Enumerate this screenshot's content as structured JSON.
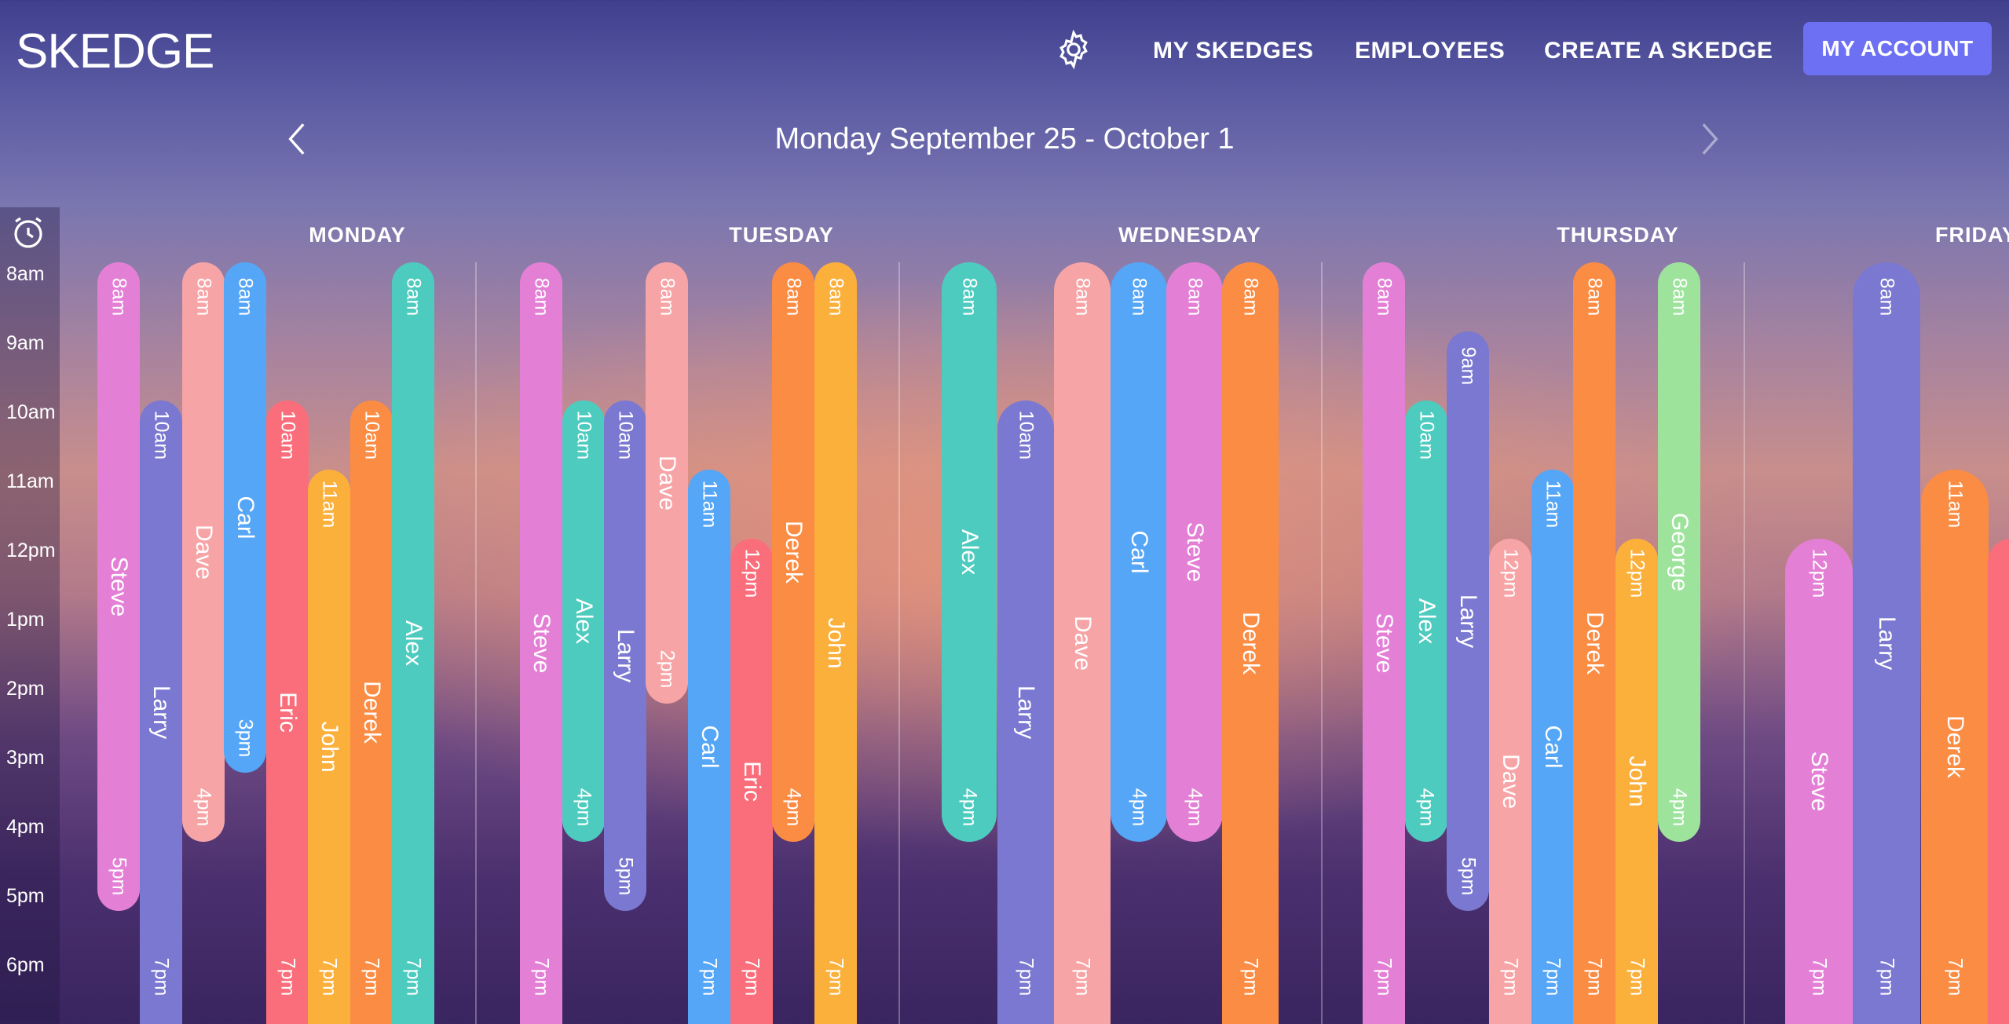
{
  "app": {
    "logo": "SKEDGE"
  },
  "nav": {
    "settings_icon": "gear-icon",
    "my_skedges": "MY SKEDGES",
    "employees": "EMPLOYEES",
    "create": "CREATE A SKEDGE",
    "account": "MY ACCOUNT"
  },
  "week": {
    "label": "Monday September 25 - October 1",
    "prev_icon": "chevron-left-icon",
    "next_icon": "chevron-right-icon"
  },
  "time_column": {
    "icon": "alarm-clock-icon",
    "hours": [
      "8am",
      "9am",
      "10am",
      "11am",
      "12pm",
      "1pm",
      "2pm",
      "3pm",
      "4pm",
      "5pm",
      "6pm"
    ]
  },
  "colors": {
    "pink": "#e47fd6",
    "periwinkle": "#7b78d1",
    "salmon": "#f7a4a6",
    "blue": "#55a6f6",
    "red": "#fa6e7b",
    "yellow": "#fbb03b",
    "orange": "#fb8c43",
    "teal": "#4ecbbf",
    "green": "#9de39c",
    "button": "#6d70f2"
  },
  "days": [
    {
      "name": "MONDAY",
      "shifts": [
        {
          "employee": "Steve",
          "start": "8am",
          "end": "5pm",
          "color": "#e47fd6"
        },
        {
          "employee": "Larry",
          "start": "10am",
          "end": "7pm",
          "color": "#7b78d1"
        },
        {
          "employee": "Dave",
          "start": "8am",
          "end": "4pm",
          "color": "#f7a4a6"
        },
        {
          "employee": "Carl",
          "start": "8am",
          "end": "3pm",
          "color": "#55a6f6"
        },
        {
          "employee": "Eric",
          "start": "10am",
          "end": "7pm",
          "color": "#fa6e7b"
        },
        {
          "employee": "John",
          "start": "11am",
          "end": "7pm",
          "color": "#fbb03b"
        },
        {
          "employee": "Derek",
          "start": "10am",
          "end": "7pm",
          "color": "#fb8c43"
        },
        {
          "employee": "Alex",
          "start": "8am",
          "end": "7pm",
          "color": "#4ecbbf"
        }
      ]
    },
    {
      "name": "TUESDAY",
      "shifts": [
        {
          "employee": "Steve",
          "start": "8am",
          "end": "7pm",
          "color": "#e47fd6"
        },
        {
          "employee": "Alex",
          "start": "10am",
          "end": "4pm",
          "color": "#4ecbbf"
        },
        {
          "employee": "Larry",
          "start": "10am",
          "end": "5pm",
          "color": "#7b78d1"
        },
        {
          "employee": "Dave",
          "start": "8am",
          "end": "2pm",
          "color": "#f7a4a6"
        },
        {
          "employee": "Carl",
          "start": "11am",
          "end": "7pm",
          "color": "#55a6f6"
        },
        {
          "employee": "Eric",
          "start": "12pm",
          "end": "7pm",
          "color": "#fa6e7b"
        },
        {
          "employee": "Derek",
          "start": "8am",
          "end": "4pm",
          "color": "#fb8c43"
        },
        {
          "employee": "John",
          "start": "8am",
          "end": "7pm",
          "color": "#fbb03b"
        }
      ]
    },
    {
      "name": "WEDNESDAY",
      "shifts": [
        {
          "employee": "Alex",
          "start": "8am",
          "end": "4pm",
          "color": "#4ecbbf"
        },
        {
          "employee": "Larry",
          "start": "10am",
          "end": "7pm",
          "color": "#7b78d1"
        },
        {
          "employee": "Dave",
          "start": "8am",
          "end": "7pm",
          "color": "#f7a4a6"
        },
        {
          "employee": "Carl",
          "start": "8am",
          "end": "4pm",
          "color": "#55a6f6"
        },
        {
          "employee": "Steve",
          "start": "8am",
          "end": "4pm",
          "color": "#e47fd6"
        },
        {
          "employee": "Derek",
          "start": "8am",
          "end": "7pm",
          "color": "#fb8c43"
        }
      ]
    },
    {
      "name": "THURSDAY",
      "shifts": [
        {
          "employee": "Steve",
          "start": "8am",
          "end": "7pm",
          "color": "#e47fd6"
        },
        {
          "employee": "Alex",
          "start": "10am",
          "end": "4pm",
          "color": "#4ecbbf"
        },
        {
          "employee": "Larry",
          "start": "9am",
          "end": "5pm",
          "color": "#7b78d1"
        },
        {
          "employee": "Dave",
          "start": "12pm",
          "end": "7pm",
          "color": "#f7a4a6"
        },
        {
          "employee": "Carl",
          "start": "11am",
          "end": "7pm",
          "color": "#55a6f6"
        },
        {
          "employee": "Derek",
          "start": "8am",
          "end": "7pm",
          "color": "#fb8c43"
        },
        {
          "employee": "John",
          "start": "12pm",
          "end": "7pm",
          "color": "#fbb03b"
        },
        {
          "employee": "George",
          "start": "8am",
          "end": "4pm",
          "color": "#9de39c"
        }
      ]
    },
    {
      "name": "FRIDAY",
      "shifts": [
        {
          "employee": "Steve",
          "start": "12pm",
          "end": "7pm",
          "color": "#e47fd6"
        },
        {
          "employee": "Larry",
          "start": "8am",
          "end": "7pm",
          "color": "#7b78d1"
        },
        {
          "employee": "Derek",
          "start": "11am",
          "end": "7pm",
          "color": "#fb8c43"
        },
        {
          "employee": "",
          "start": "",
          "end": "",
          "color": "#fa6e7b"
        }
      ]
    }
  ]
}
